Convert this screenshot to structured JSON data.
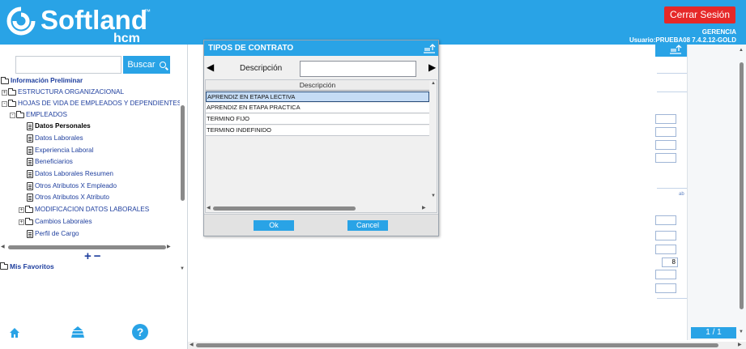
{
  "header": {
    "brand_name": "Softland",
    "brand_tm": "™",
    "brand_sub": "hcm",
    "logout_label": "Cerrar Sesión",
    "user_line1": "GERENCIA",
    "user_line2": "Usuario:PRUEBA08 7.4.2.12-GOLD",
    "accent_color": "#29a3e6",
    "logout_color": "#e62828"
  },
  "sidebar": {
    "search_value": "",
    "search_button": "Buscar",
    "tree": [
      {
        "label": "Información Preliminar",
        "icon": "folder-icon",
        "expander": ""
      },
      {
        "label": "ESTRUCTURA ORGANIZACIONAL",
        "icon": "folder-icon",
        "expander": "+"
      },
      {
        "label": "HOJAS DE VIDA DE EMPLEADOS Y DEPENDIENTES",
        "icon": "folder-icon",
        "expander": "-"
      },
      {
        "label": "EMPLEADOS",
        "icon": "folder-icon",
        "expander": "-"
      },
      {
        "label": "Datos Personales",
        "icon": "document-icon",
        "expander": ""
      },
      {
        "label": "Datos Laborales",
        "icon": "document-icon",
        "expander": ""
      },
      {
        "label": "Experiencia Laboral",
        "icon": "document-icon",
        "expander": ""
      },
      {
        "label": "Beneficiarios",
        "icon": "document-icon",
        "expander": ""
      },
      {
        "label": "Datos Laborales Resumen",
        "icon": "document-icon",
        "expander": ""
      },
      {
        "label": "Otros Atributos X Empleado",
        "icon": "document-icon",
        "expander": ""
      },
      {
        "label": "Otros Atributos X Atributo",
        "icon": "document-icon",
        "expander": ""
      },
      {
        "label": "MODIFICACION DATOS LABORALES",
        "icon": "folder-icon",
        "expander": "+"
      },
      {
        "label": "Cambios Laborales",
        "icon": "folder-icon",
        "expander": "+"
      },
      {
        "label": "Perfil de Cargo",
        "icon": "document-icon",
        "expander": ""
      }
    ],
    "selected_item": "Datos Personales",
    "expand_all": "+",
    "collapse_all": "−",
    "favorites_label": "Mis Favoritos",
    "help_label": "?"
  },
  "dialog": {
    "title": "TIPOS DE CONTRATO",
    "filter_label": "Descripción",
    "filter_value": "",
    "column_header": "Descripción",
    "rows": [
      "APRENDIZ EN ETAPA LECTIVA",
      "APRENDIZ EN ETAPA PRACTICA",
      "TERMINO FIJO",
      "TERMINO INDEFINIDO"
    ],
    "selected_row": "APRENDIZ EN ETAPA LECTIVA",
    "ok_label": "Ok",
    "cancel_label": "Cancel"
  },
  "form": {
    "field_value": "8",
    "tag": "ab",
    "pager": "1 / 1"
  }
}
